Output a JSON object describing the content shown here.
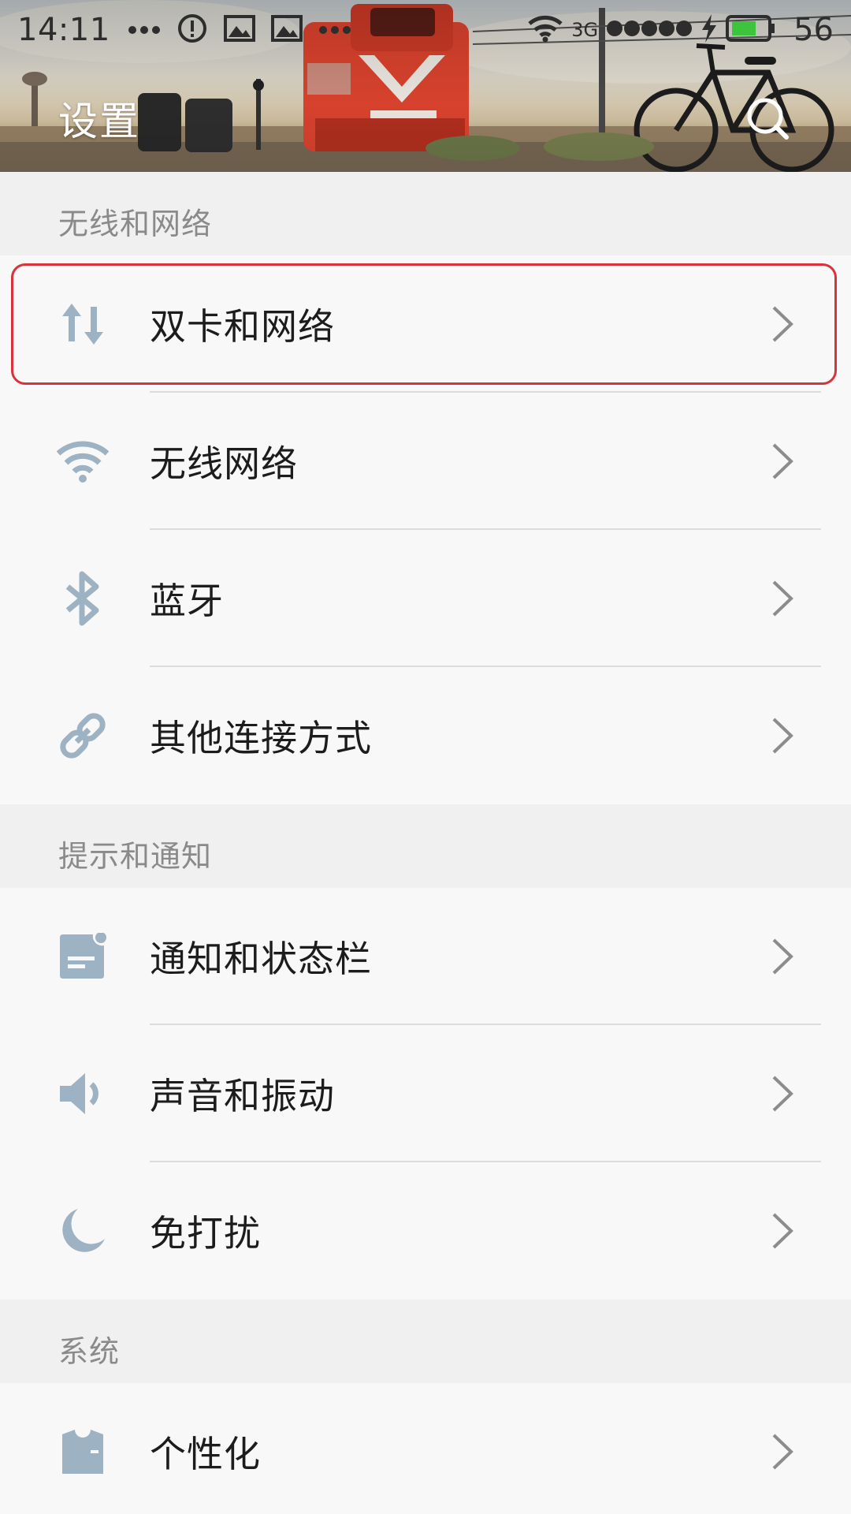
{
  "status_bar": {
    "time": "14:11",
    "network_type": "3G",
    "battery_percent": "56"
  },
  "header": {
    "title": "设置"
  },
  "sections": [
    {
      "header": "无线和网络",
      "items": [
        {
          "label": "双卡和网络",
          "icon": "data-arrows-icon"
        },
        {
          "label": "无线网络",
          "icon": "wifi-icon"
        },
        {
          "label": "蓝牙",
          "icon": "bluetooth-icon"
        },
        {
          "label": "其他连接方式",
          "icon": "link-icon"
        }
      ]
    },
    {
      "header": "提示和通知",
      "items": [
        {
          "label": "通知和状态栏",
          "icon": "notification-icon"
        },
        {
          "label": "声音和振动",
          "icon": "speaker-icon"
        },
        {
          "label": "免打扰",
          "icon": "moon-icon"
        }
      ]
    },
    {
      "header": "系统",
      "items": [
        {
          "label": "个性化",
          "icon": "shirt-icon"
        }
      ]
    }
  ],
  "colors": {
    "icon": "#9db2c2",
    "highlight": "#d8323c",
    "section_bg": "#f0f0f0",
    "row_bg": "#f8f8f8"
  }
}
